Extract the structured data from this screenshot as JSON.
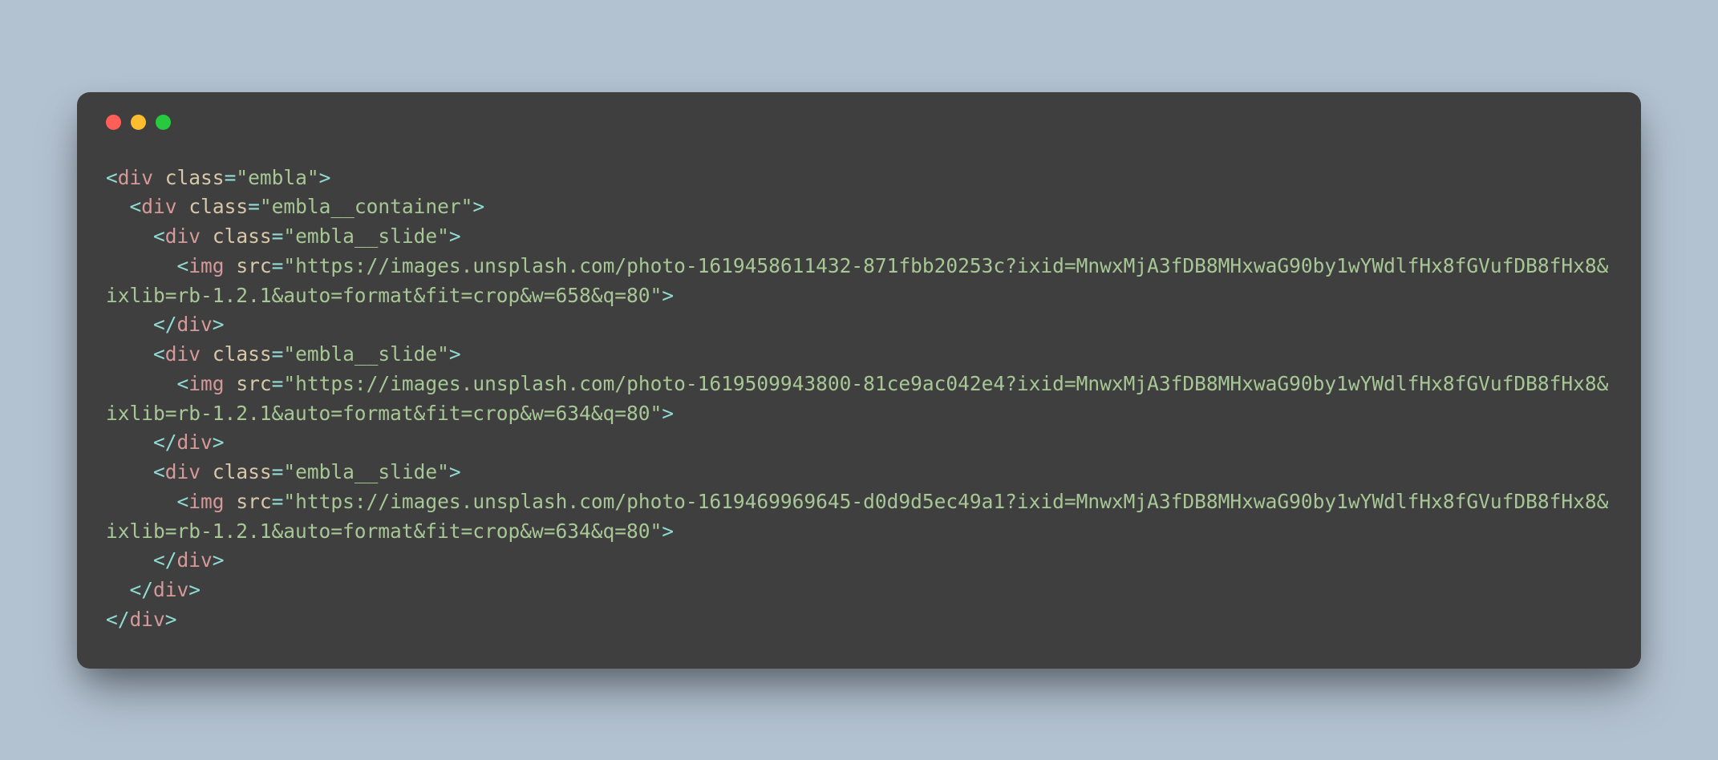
{
  "code": {
    "lines": [
      [
        {
          "t": "<",
          "c": "punct"
        },
        {
          "t": "div",
          "c": "tag"
        },
        {
          "t": " ",
          "c": "attr"
        },
        {
          "t": "class",
          "c": "attr"
        },
        {
          "t": "=",
          "c": "eq"
        },
        {
          "t": "\"embla\"",
          "c": "string"
        },
        {
          "t": ">",
          "c": "punct"
        }
      ],
      [
        {
          "t": "  ",
          "c": "attr"
        },
        {
          "t": "<",
          "c": "punct"
        },
        {
          "t": "div",
          "c": "tag"
        },
        {
          "t": " ",
          "c": "attr"
        },
        {
          "t": "class",
          "c": "attr"
        },
        {
          "t": "=",
          "c": "eq"
        },
        {
          "t": "\"embla__container\"",
          "c": "string"
        },
        {
          "t": ">",
          "c": "punct"
        }
      ],
      [
        {
          "t": "    ",
          "c": "attr"
        },
        {
          "t": "<",
          "c": "punct"
        },
        {
          "t": "div",
          "c": "tag"
        },
        {
          "t": " ",
          "c": "attr"
        },
        {
          "t": "class",
          "c": "attr"
        },
        {
          "t": "=",
          "c": "eq"
        },
        {
          "t": "\"embla__slide\"",
          "c": "string"
        },
        {
          "t": ">",
          "c": "punct"
        }
      ],
      [
        {
          "t": "      ",
          "c": "attr"
        },
        {
          "t": "<",
          "c": "punct"
        },
        {
          "t": "img",
          "c": "tag"
        },
        {
          "t": " ",
          "c": "attr"
        },
        {
          "t": "src",
          "c": "attr"
        },
        {
          "t": "=",
          "c": "eq"
        },
        {
          "t": "\"https://images.unsplash.com/photo-1619458611432-871fbb20253c?ixid=MnwxMjA3fDB8MHxwaG90by1wYWdlfHx8fGVufDB8fHx8&ixlib=rb-1.2.1&auto=format&fit=crop&w=658&q=80\"",
          "c": "string"
        },
        {
          "t": ">",
          "c": "punct"
        }
      ],
      [
        {
          "t": "    ",
          "c": "attr"
        },
        {
          "t": "</",
          "c": "punct"
        },
        {
          "t": "div",
          "c": "tag"
        },
        {
          "t": ">",
          "c": "punct"
        }
      ],
      [
        {
          "t": "    ",
          "c": "attr"
        },
        {
          "t": "<",
          "c": "punct"
        },
        {
          "t": "div",
          "c": "tag"
        },
        {
          "t": " ",
          "c": "attr"
        },
        {
          "t": "class",
          "c": "attr"
        },
        {
          "t": "=",
          "c": "eq"
        },
        {
          "t": "\"embla__slide\"",
          "c": "string"
        },
        {
          "t": ">",
          "c": "punct"
        }
      ],
      [
        {
          "t": "      ",
          "c": "attr"
        },
        {
          "t": "<",
          "c": "punct"
        },
        {
          "t": "img",
          "c": "tag"
        },
        {
          "t": " ",
          "c": "attr"
        },
        {
          "t": "src",
          "c": "attr"
        },
        {
          "t": "=",
          "c": "eq"
        },
        {
          "t": "\"https://images.unsplash.com/photo-1619509943800-81ce9ac042e4?ixid=MnwxMjA3fDB8MHxwaG90by1wYWdlfHx8fGVufDB8fHx8&ixlib=rb-1.2.1&auto=format&fit=crop&w=634&q=80\"",
          "c": "string"
        },
        {
          "t": ">",
          "c": "punct"
        }
      ],
      [
        {
          "t": "    ",
          "c": "attr"
        },
        {
          "t": "</",
          "c": "punct"
        },
        {
          "t": "div",
          "c": "tag"
        },
        {
          "t": ">",
          "c": "punct"
        }
      ],
      [
        {
          "t": "    ",
          "c": "attr"
        },
        {
          "t": "<",
          "c": "punct"
        },
        {
          "t": "div",
          "c": "tag"
        },
        {
          "t": " ",
          "c": "attr"
        },
        {
          "t": "class",
          "c": "attr"
        },
        {
          "t": "=",
          "c": "eq"
        },
        {
          "t": "\"embla__slide\"",
          "c": "string"
        },
        {
          "t": ">",
          "c": "punct"
        }
      ],
      [
        {
          "t": "      ",
          "c": "attr"
        },
        {
          "t": "<",
          "c": "punct"
        },
        {
          "t": "img",
          "c": "tag"
        },
        {
          "t": " ",
          "c": "attr"
        },
        {
          "t": "src",
          "c": "attr"
        },
        {
          "t": "=",
          "c": "eq"
        },
        {
          "t": "\"https://images.unsplash.com/photo-1619469969645-d0d9d5ec49a1?ixid=MnwxMjA3fDB8MHxwaG90by1wYWdlfHx8fGVufDB8fHx8&ixlib=rb-1.2.1&auto=format&fit=crop&w=634&q=80\"",
          "c": "string"
        },
        {
          "t": ">",
          "c": "punct"
        }
      ],
      [
        {
          "t": "    ",
          "c": "attr"
        },
        {
          "t": "</",
          "c": "punct"
        },
        {
          "t": "div",
          "c": "tag"
        },
        {
          "t": ">",
          "c": "punct"
        }
      ],
      [
        {
          "t": "  ",
          "c": "attr"
        },
        {
          "t": "</",
          "c": "punct"
        },
        {
          "t": "div",
          "c": "tag"
        },
        {
          "t": ">",
          "c": "punct"
        }
      ],
      [
        {
          "t": "</",
          "c": "punct"
        },
        {
          "t": "div",
          "c": "tag"
        },
        {
          "t": ">",
          "c": "punct"
        }
      ]
    ]
  }
}
